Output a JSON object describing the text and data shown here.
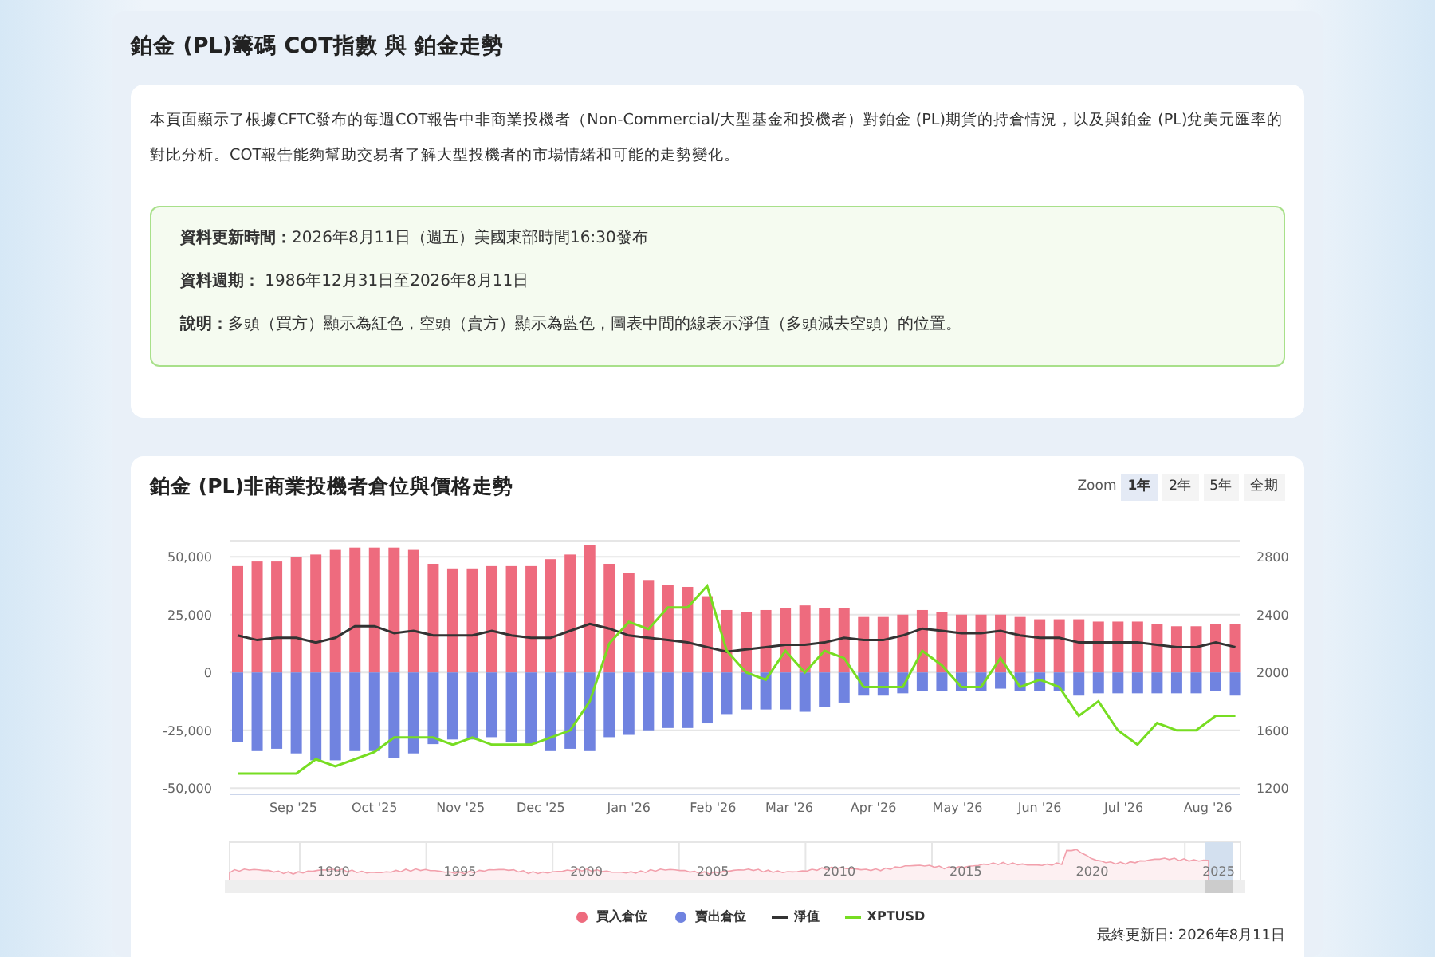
{
  "page_title": "鉑金 (PL)籌碼 COT指數 與 鉑金走勢",
  "intro": "本頁面顯示了根據CFTC發布的每週COT報告中非商業投機者（Non-Commercial/大型基金和投機者）對鉑金 (PL)期貨的持倉情況，以及與鉑金 (PL)兌美元匯率的對比分析。COT報告能夠幫助交易者了解大型投機者的市場情緒和可能的走勢變化。",
  "info_lines": [
    "**資料更新時間：**2026年8月11日（週五）美國東部時間16:30發布",
    "**資料週期：** 1986年12月31日至2026年8月11日",
    "**說明：**多頭（買方）顯示為紅色，空頭（賣方）顯示為藍色，圖表中間的線表示淨值（多頭減去空頭）的位置。"
  ],
  "chart_card": {
    "title": "鉑金 (PL)非商業投機者倉位與價格走勢",
    "zoom_label": "Zoom",
    "zoom_buttons": [
      {
        "label": "1年",
        "selected": true
      },
      {
        "label": "2年",
        "selected": false
      },
      {
        "label": "5年",
        "selected": false
      },
      {
        "label": "全期",
        "selected": false
      }
    ],
    "x_axis_labels": [
      "Sep '25",
      "Oct '25",
      "Nov '25",
      "Dec '25",
      "Jan '26",
      "Feb '26",
      "Mar '26",
      "Apr '26",
      "May '26",
      "Jun '26",
      "Jul '26",
      "Aug '26"
    ],
    "chart_data": {
      "type": "bar",
      "stacked": true,
      "grid": true,
      "ylim": [
        -52000,
        57000
      ],
      "yticks": [
        {
          "value": 50000,
          "label": "50,000"
        },
        {
          "value": 25000,
          "label": "25,000"
        },
        {
          "value": 0,
          "label": "0"
        },
        {
          "value": -25000,
          "label": "-25,000"
        },
        {
          "value": -50000,
          "label": "-50,000"
        }
      ],
      "series": [
        {
          "name": "買入倉位",
          "color": "#ee6b7e",
          "type": "bar",
          "values": [
            46000,
            48000,
            48000,
            50000,
            51000,
            53000,
            54000,
            54000,
            54000,
            53000,
            47000,
            45000,
            45000,
            46000,
            46000,
            46000,
            49000,
            51000,
            55000,
            47000,
            43000,
            40000,
            38000,
            37000,
            33000,
            27000,
            26000,
            27000,
            28000,
            29000,
            28000,
            28000,
            24000,
            24000,
            25000,
            27000,
            26000,
            25000,
            25000,
            25000,
            24000,
            23000,
            23000,
            23000,
            22000,
            22000,
            22000,
            21000,
            20000,
            20000,
            21000,
            21000
          ]
        },
        {
          "name": "賣出倉位",
          "color": "#7083e0",
          "type": "bar",
          "values": [
            -30000,
            -34000,
            -33000,
            -35000,
            -38000,
            -38000,
            -34000,
            -34000,
            -37000,
            -35000,
            -31000,
            -29000,
            -29000,
            -28000,
            -30000,
            -31000,
            -34000,
            -33000,
            -34000,
            -28000,
            -27000,
            -25000,
            -24000,
            -24000,
            -22000,
            -18000,
            -16000,
            -16000,
            -16000,
            -17000,
            -15000,
            -13000,
            -10000,
            -10000,
            -9000,
            -8000,
            -8000,
            -8000,
            -8000,
            -7000,
            -8000,
            -8000,
            -8000,
            -10000,
            -9000,
            -9000,
            -9000,
            -9000,
            -9000,
            -9000,
            -8000,
            -10000
          ]
        },
        {
          "name": "淨值",
          "color": "#333333",
          "type": "line",
          "values": [
            16000,
            14000,
            15000,
            15000,
            13000,
            15000,
            20000,
            20000,
            17000,
            18000,
            16000,
            16000,
            16000,
            18000,
            16000,
            15000,
            15000,
            18000,
            21000,
            19000,
            16000,
            15000,
            14000,
            13000,
            11000,
            9000,
            10000,
            11000,
            12000,
            12000,
            13000,
            15000,
            14000,
            14000,
            16000,
            19000,
            18000,
            17000,
            17000,
            18000,
            16000,
            15000,
            15000,
            13000,
            13000,
            13000,
            13000,
            12000,
            11000,
            11000,
            13000,
            11000
          ]
        }
      ]
    },
    "price_overlay": {
      "chart_data": {
        "type": "line",
        "ylim": [
          1200,
          2800
        ],
        "yticks": [
          {
            "value": 2800,
            "label": "2800"
          },
          {
            "value": 2400,
            "label": "2400"
          },
          {
            "value": 2000,
            "label": "2000"
          },
          {
            "value": 1600,
            "label": "1600"
          },
          {
            "value": 1200,
            "label": "1200"
          }
        ],
        "series": [
          {
            "name": "XPTUSD",
            "color": "#77dd22",
            "values": [
              1300,
              1300,
              1300,
              1300,
              1400,
              1350,
              1400,
              1450,
              1550,
              1550,
              1550,
              1500,
              1550,
              1500,
              1500,
              1500,
              1550,
              1600,
              1800,
              2200,
              2350,
              2300,
              2450,
              2450,
              2600,
              2150,
              2000,
              1950,
              2150,
              2000,
              2150,
              2100,
              1900,
              1900,
              1900,
              2150,
              2050,
              1900,
              1900,
              2100,
              1900,
              1950,
              1900,
              1700,
              1800,
              1600,
              1500,
              1650,
              1600,
              1600,
              1700,
              1700
            ]
          }
        ]
      }
    },
    "navigator_labels": [
      "1990",
      "1995",
      "2000",
      "2005",
      "2010",
      "2015",
      "2020",
      "2025"
    ],
    "updated": "最終更新日: 2026年8月11日"
  }
}
